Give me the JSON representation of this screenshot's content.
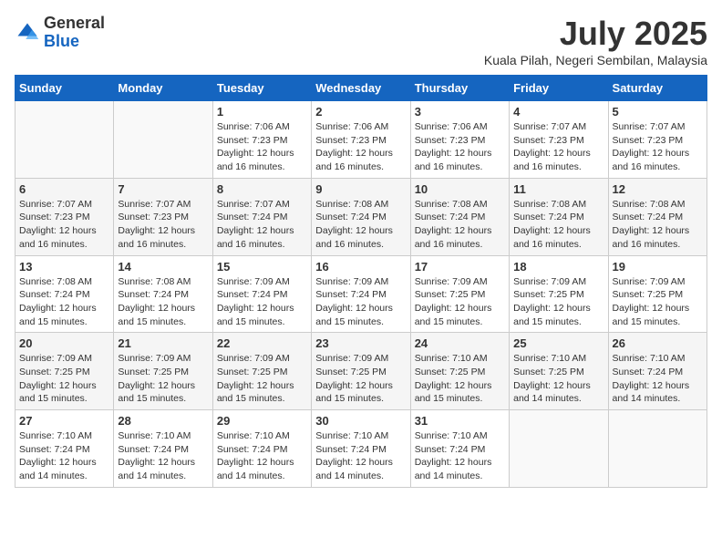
{
  "logo": {
    "text_general": "General",
    "text_blue": "Blue"
  },
  "title": "July 2025",
  "location": "Kuala Pilah, Negeri Sembilan, Malaysia",
  "days_of_week": [
    "Sunday",
    "Monday",
    "Tuesday",
    "Wednesday",
    "Thursday",
    "Friday",
    "Saturday"
  ],
  "weeks": [
    [
      {
        "day": "",
        "sunrise": "",
        "sunset": "",
        "daylight": ""
      },
      {
        "day": "",
        "sunrise": "",
        "sunset": "",
        "daylight": ""
      },
      {
        "day": "1",
        "sunrise": "Sunrise: 7:06 AM",
        "sunset": "Sunset: 7:23 PM",
        "daylight": "Daylight: 12 hours and 16 minutes."
      },
      {
        "day": "2",
        "sunrise": "Sunrise: 7:06 AM",
        "sunset": "Sunset: 7:23 PM",
        "daylight": "Daylight: 12 hours and 16 minutes."
      },
      {
        "day": "3",
        "sunrise": "Sunrise: 7:06 AM",
        "sunset": "Sunset: 7:23 PM",
        "daylight": "Daylight: 12 hours and 16 minutes."
      },
      {
        "day": "4",
        "sunrise": "Sunrise: 7:07 AM",
        "sunset": "Sunset: 7:23 PM",
        "daylight": "Daylight: 12 hours and 16 minutes."
      },
      {
        "day": "5",
        "sunrise": "Sunrise: 7:07 AM",
        "sunset": "Sunset: 7:23 PM",
        "daylight": "Daylight: 12 hours and 16 minutes."
      }
    ],
    [
      {
        "day": "6",
        "sunrise": "Sunrise: 7:07 AM",
        "sunset": "Sunset: 7:23 PM",
        "daylight": "Daylight: 12 hours and 16 minutes."
      },
      {
        "day": "7",
        "sunrise": "Sunrise: 7:07 AM",
        "sunset": "Sunset: 7:23 PM",
        "daylight": "Daylight: 12 hours and 16 minutes."
      },
      {
        "day": "8",
        "sunrise": "Sunrise: 7:07 AM",
        "sunset": "Sunset: 7:24 PM",
        "daylight": "Daylight: 12 hours and 16 minutes."
      },
      {
        "day": "9",
        "sunrise": "Sunrise: 7:08 AM",
        "sunset": "Sunset: 7:24 PM",
        "daylight": "Daylight: 12 hours and 16 minutes."
      },
      {
        "day": "10",
        "sunrise": "Sunrise: 7:08 AM",
        "sunset": "Sunset: 7:24 PM",
        "daylight": "Daylight: 12 hours and 16 minutes."
      },
      {
        "day": "11",
        "sunrise": "Sunrise: 7:08 AM",
        "sunset": "Sunset: 7:24 PM",
        "daylight": "Daylight: 12 hours and 16 minutes."
      },
      {
        "day": "12",
        "sunrise": "Sunrise: 7:08 AM",
        "sunset": "Sunset: 7:24 PM",
        "daylight": "Daylight: 12 hours and 16 minutes."
      }
    ],
    [
      {
        "day": "13",
        "sunrise": "Sunrise: 7:08 AM",
        "sunset": "Sunset: 7:24 PM",
        "daylight": "Daylight: 12 hours and 15 minutes."
      },
      {
        "day": "14",
        "sunrise": "Sunrise: 7:08 AM",
        "sunset": "Sunset: 7:24 PM",
        "daylight": "Daylight: 12 hours and 15 minutes."
      },
      {
        "day": "15",
        "sunrise": "Sunrise: 7:09 AM",
        "sunset": "Sunset: 7:24 PM",
        "daylight": "Daylight: 12 hours and 15 minutes."
      },
      {
        "day": "16",
        "sunrise": "Sunrise: 7:09 AM",
        "sunset": "Sunset: 7:24 PM",
        "daylight": "Daylight: 12 hours and 15 minutes."
      },
      {
        "day": "17",
        "sunrise": "Sunrise: 7:09 AM",
        "sunset": "Sunset: 7:25 PM",
        "daylight": "Daylight: 12 hours and 15 minutes."
      },
      {
        "day": "18",
        "sunrise": "Sunrise: 7:09 AM",
        "sunset": "Sunset: 7:25 PM",
        "daylight": "Daylight: 12 hours and 15 minutes."
      },
      {
        "day": "19",
        "sunrise": "Sunrise: 7:09 AM",
        "sunset": "Sunset: 7:25 PM",
        "daylight": "Daylight: 12 hours and 15 minutes."
      }
    ],
    [
      {
        "day": "20",
        "sunrise": "Sunrise: 7:09 AM",
        "sunset": "Sunset: 7:25 PM",
        "daylight": "Daylight: 12 hours and 15 minutes."
      },
      {
        "day": "21",
        "sunrise": "Sunrise: 7:09 AM",
        "sunset": "Sunset: 7:25 PM",
        "daylight": "Daylight: 12 hours and 15 minutes."
      },
      {
        "day": "22",
        "sunrise": "Sunrise: 7:09 AM",
        "sunset": "Sunset: 7:25 PM",
        "daylight": "Daylight: 12 hours and 15 minutes."
      },
      {
        "day": "23",
        "sunrise": "Sunrise: 7:09 AM",
        "sunset": "Sunset: 7:25 PM",
        "daylight": "Daylight: 12 hours and 15 minutes."
      },
      {
        "day": "24",
        "sunrise": "Sunrise: 7:10 AM",
        "sunset": "Sunset: 7:25 PM",
        "daylight": "Daylight: 12 hours and 15 minutes."
      },
      {
        "day": "25",
        "sunrise": "Sunrise: 7:10 AM",
        "sunset": "Sunset: 7:25 PM",
        "daylight": "Daylight: 12 hours and 14 minutes."
      },
      {
        "day": "26",
        "sunrise": "Sunrise: 7:10 AM",
        "sunset": "Sunset: 7:24 PM",
        "daylight": "Daylight: 12 hours and 14 minutes."
      }
    ],
    [
      {
        "day": "27",
        "sunrise": "Sunrise: 7:10 AM",
        "sunset": "Sunset: 7:24 PM",
        "daylight": "Daylight: 12 hours and 14 minutes."
      },
      {
        "day": "28",
        "sunrise": "Sunrise: 7:10 AM",
        "sunset": "Sunset: 7:24 PM",
        "daylight": "Daylight: 12 hours and 14 minutes."
      },
      {
        "day": "29",
        "sunrise": "Sunrise: 7:10 AM",
        "sunset": "Sunset: 7:24 PM",
        "daylight": "Daylight: 12 hours and 14 minutes."
      },
      {
        "day": "30",
        "sunrise": "Sunrise: 7:10 AM",
        "sunset": "Sunset: 7:24 PM",
        "daylight": "Daylight: 12 hours and 14 minutes."
      },
      {
        "day": "31",
        "sunrise": "Sunrise: 7:10 AM",
        "sunset": "Sunset: 7:24 PM",
        "daylight": "Daylight: 12 hours and 14 minutes."
      },
      {
        "day": "",
        "sunrise": "",
        "sunset": "",
        "daylight": ""
      },
      {
        "day": "",
        "sunrise": "",
        "sunset": "",
        "daylight": ""
      }
    ]
  ]
}
